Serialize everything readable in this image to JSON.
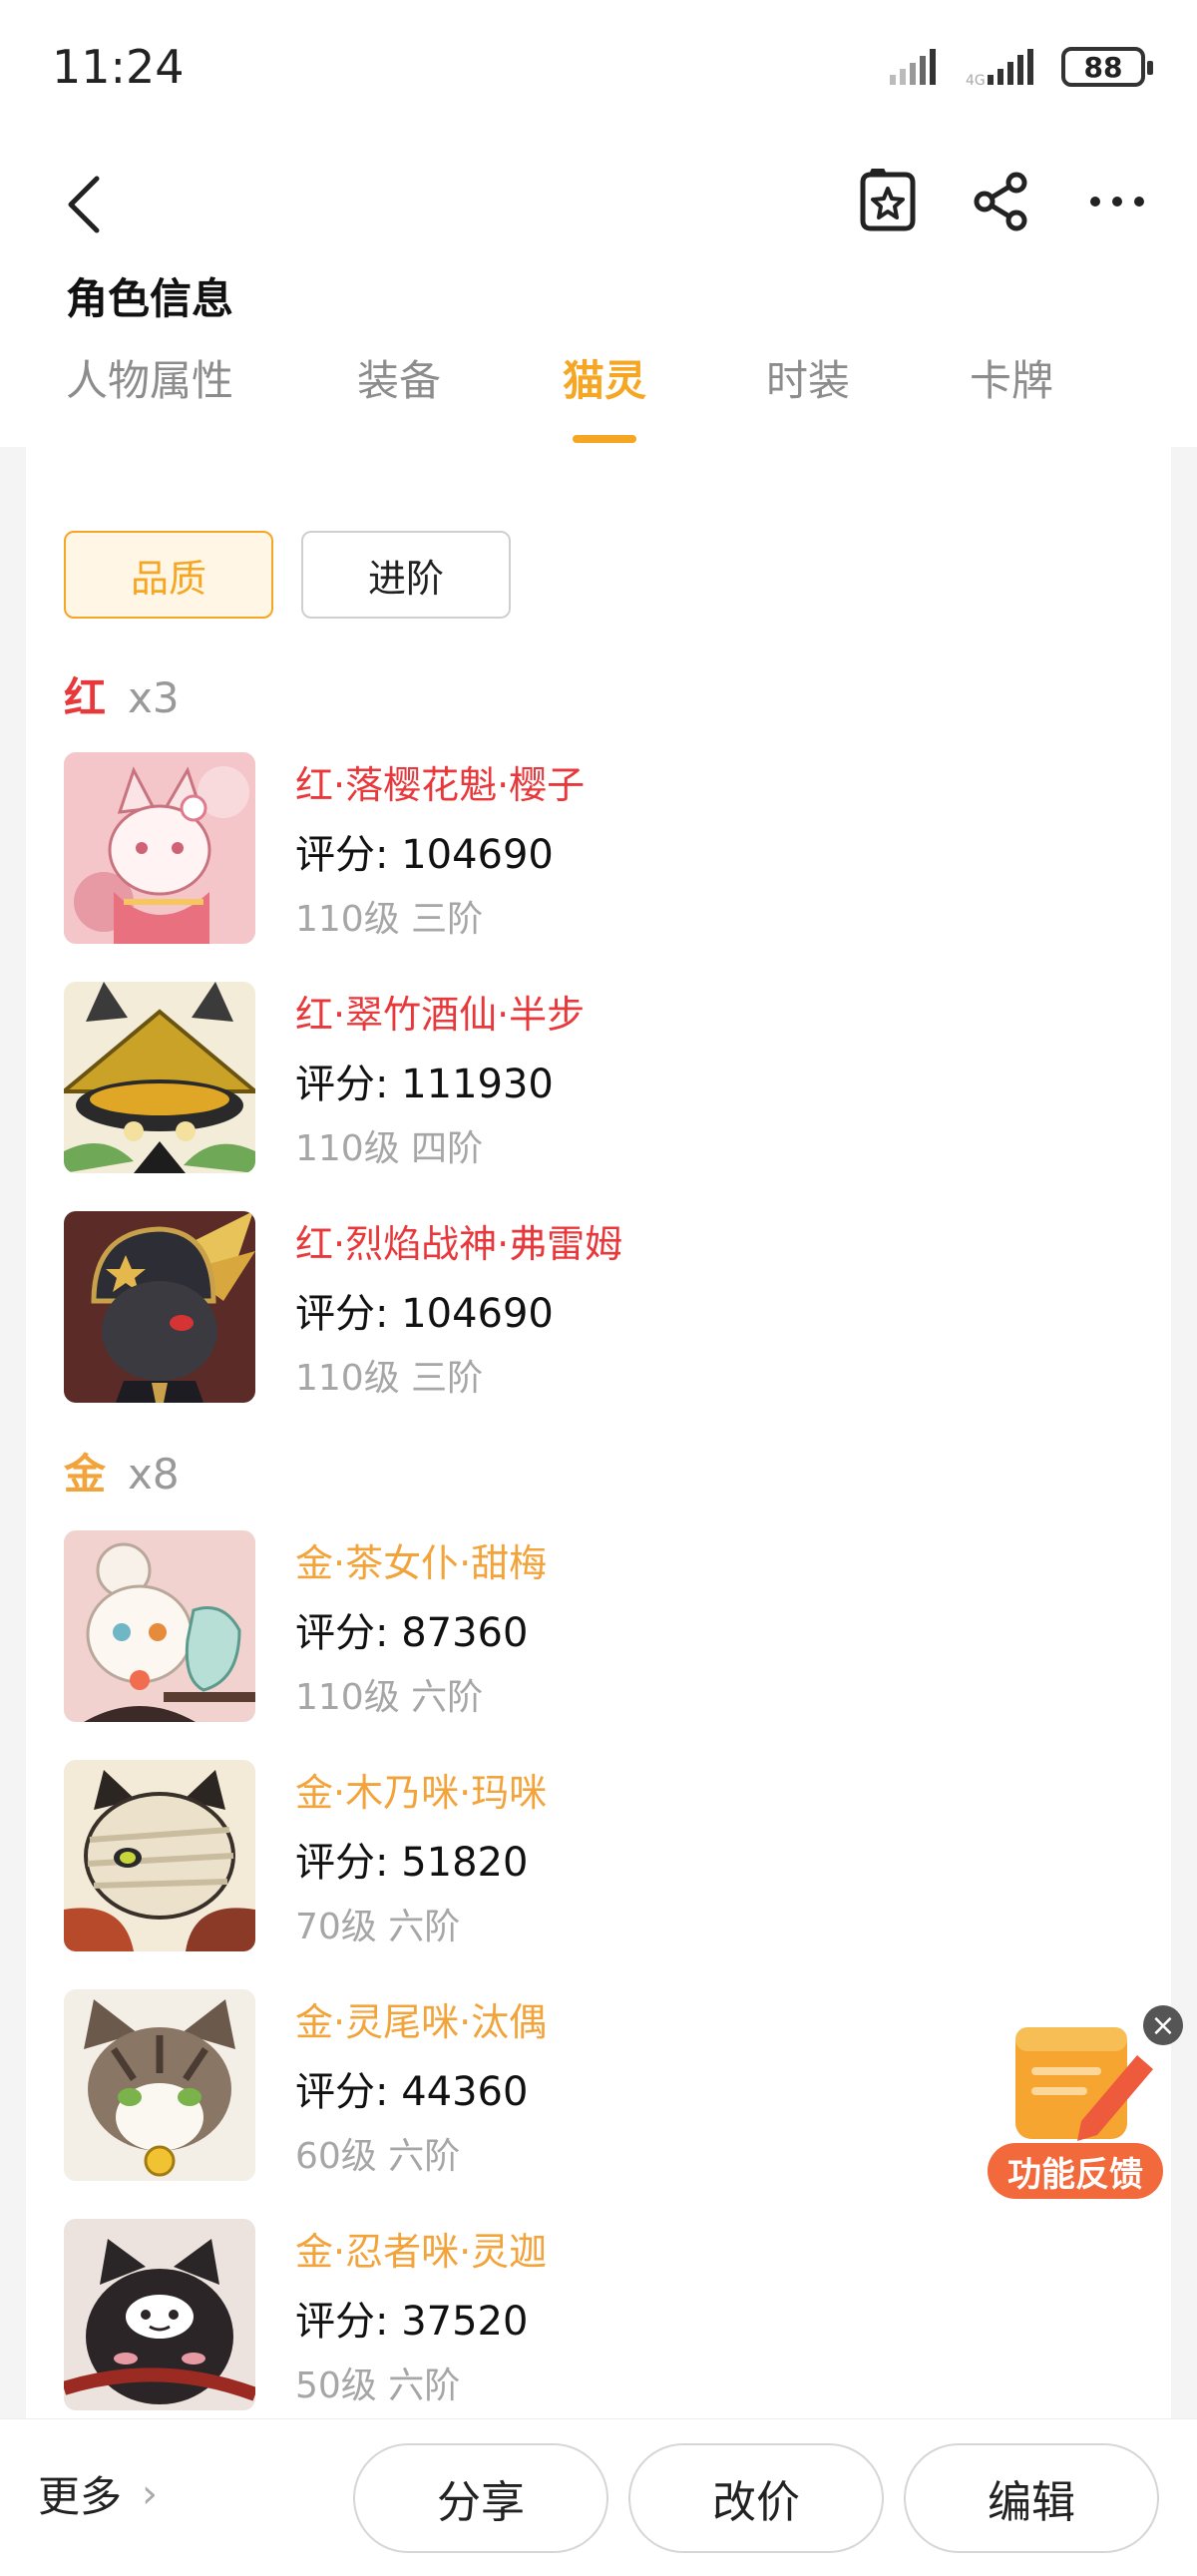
{
  "status": {
    "time": "11:24",
    "battery": "88"
  },
  "header": {
    "title": "角色信息"
  },
  "tabs": [
    {
      "label": "人物属性",
      "active": false
    },
    {
      "label": "装备",
      "active": false
    },
    {
      "label": "猫灵",
      "active": true
    },
    {
      "label": "时装",
      "active": false
    },
    {
      "label": "卡牌",
      "active": false
    }
  ],
  "filters": [
    {
      "label": "品质",
      "active": true
    },
    {
      "label": "进阶",
      "active": false
    }
  ],
  "groups": [
    {
      "name": "红",
      "count": "x3",
      "color": "#e8383b",
      "pets": [
        {
          "name": "红·落樱花魁·樱子",
          "score": "评分: 104690",
          "level": "110级 三阶",
          "avatar": "pink-kitsune-cat"
        },
        {
          "name": "红·翠竹酒仙·半步",
          "score": "评分: 111930",
          "level": "110级 四阶",
          "avatar": "black-cat-straw-hat"
        },
        {
          "name": "红·烈焰战神·弗雷姆",
          "score": "评分: 104690",
          "level": "110级 三阶",
          "avatar": "dark-cat-golden-helmet"
        }
      ]
    },
    {
      "name": "金",
      "count": "x8",
      "color": "#f2a33a",
      "pets": [
        {
          "name": "金·茶女仆·甜梅",
          "score": "评分: 87360",
          "level": "110级 六阶",
          "avatar": "white-cat-maid-teapot"
        },
        {
          "name": "金·木乃咪·玛咪",
          "score": "评分: 51820",
          "level": "70级 六阶",
          "avatar": "mummy-cat"
        },
        {
          "name": "金·灵尾咪·汰偶",
          "score": "评分: 44360",
          "level": "60级 六阶",
          "avatar": "tabby-cat-bell"
        },
        {
          "name": "金·忍者咪·灵迦",
          "score": "评分: 37520",
          "level": "50级 六阶",
          "avatar": "black-ninja-cat"
        }
      ]
    }
  ],
  "feedback": {
    "label": "功能反馈"
  },
  "bottom": {
    "more": "更多",
    "share": "分享",
    "price": "改价",
    "edit": "编辑"
  }
}
